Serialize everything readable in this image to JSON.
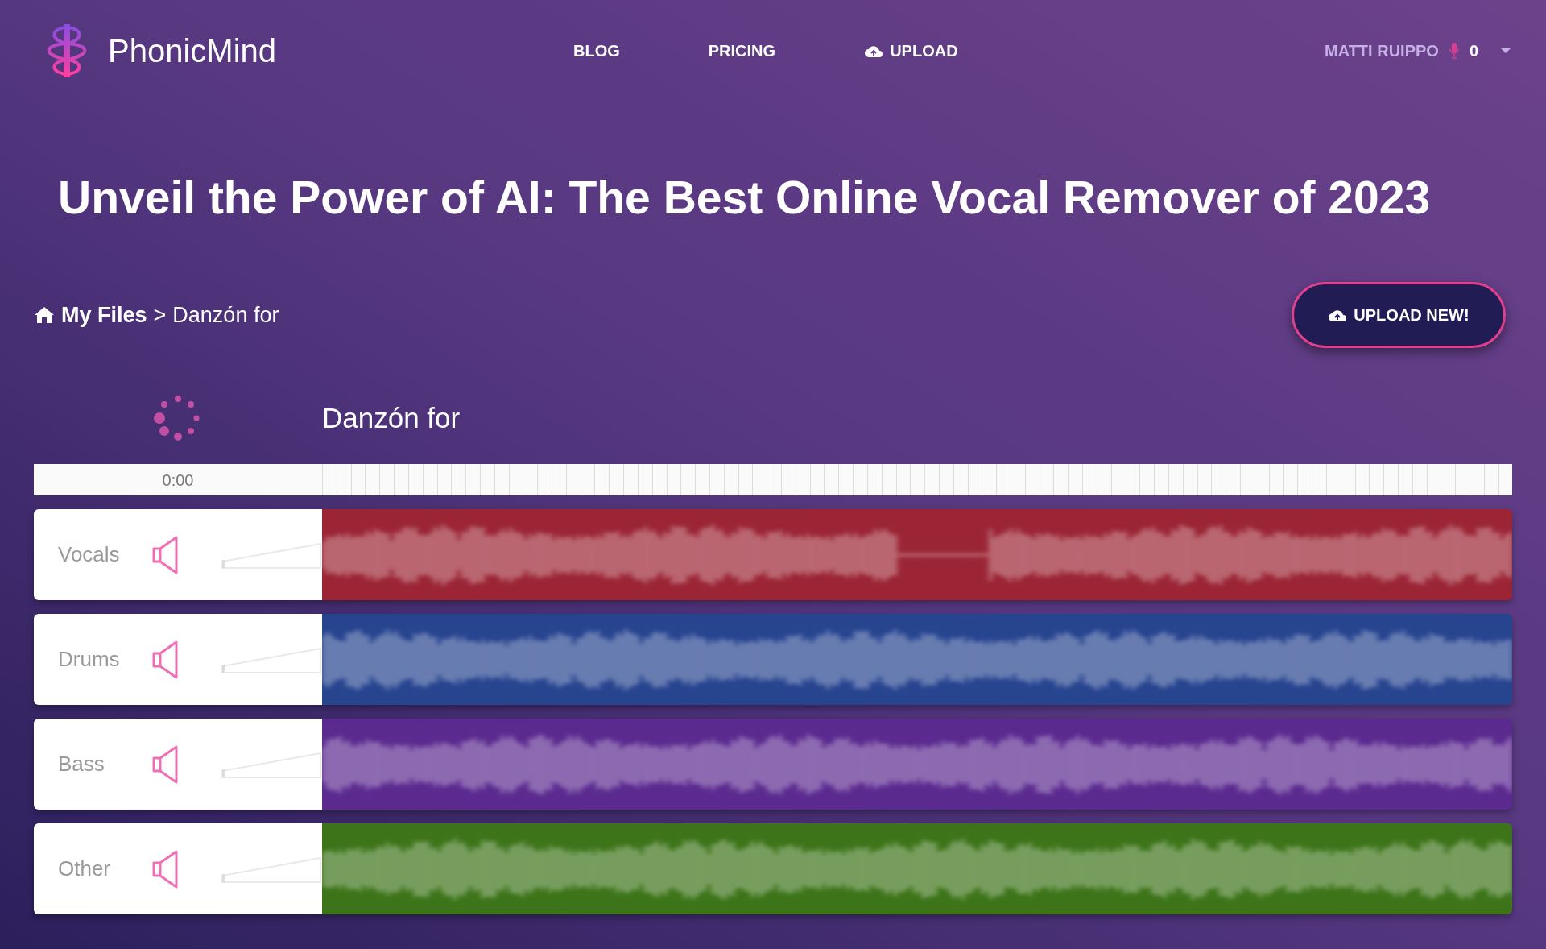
{
  "brand": "PhonicMind",
  "nav": [
    "BLOG",
    "PRICING",
    "UPLOAD"
  ],
  "user": {
    "name": "MATTI RUIPPO",
    "credits": "0"
  },
  "headline": "Unveil the Power of AI: The Best Online Vocal Remover of 2023",
  "breadcrumb": {
    "root": "My Files",
    "separator": ">",
    "current": "Danzón for"
  },
  "upload_button": "UPLOAD NEW!",
  "track_title": "Danzón for",
  "timeline": {
    "start": "0:00"
  },
  "tracks": [
    {
      "name": "Vocals",
      "color": "#9b2535",
      "level": 0
    },
    {
      "name": "Drums",
      "color": "#27448f",
      "level": 0
    },
    {
      "name": "Bass",
      "color": "#5b2a8f",
      "level": 0
    },
    {
      "name": "Other",
      "color": "#3d7419",
      "level": 0
    }
  ]
}
